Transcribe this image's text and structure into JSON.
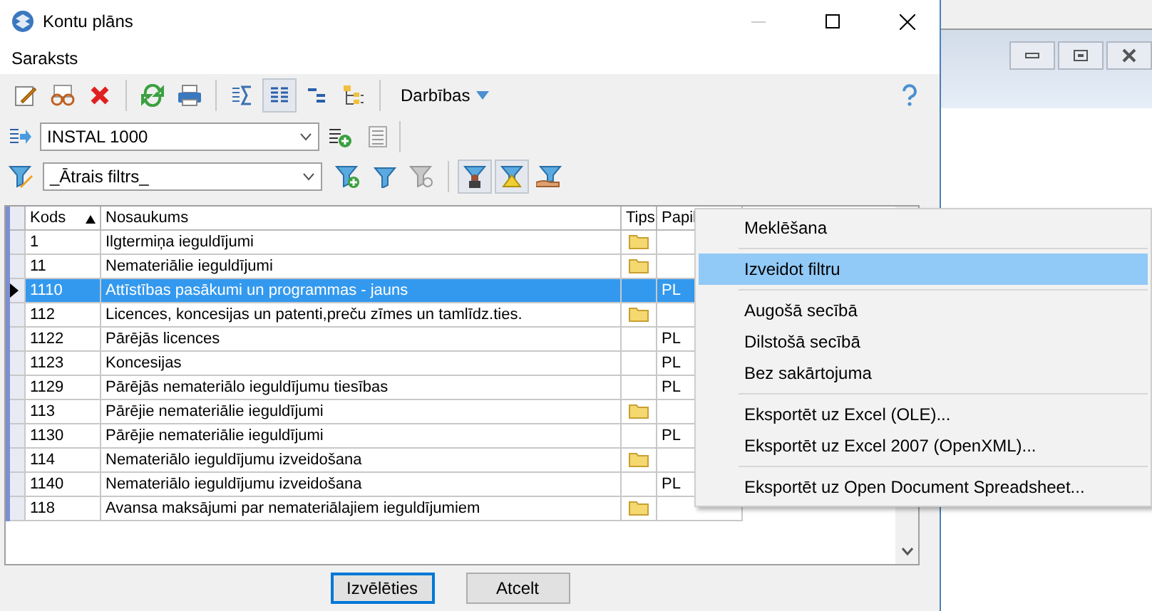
{
  "window": {
    "title": "Kontu plāns"
  },
  "menu": [
    "Saraksts"
  ],
  "toolbar": {
    "icons": [
      {
        "kind": "edit",
        "pressed": false
      },
      {
        "kind": "glasses",
        "pressed": false
      },
      {
        "kind": "delete",
        "pressed": false
      },
      {
        "kind": "sep"
      },
      {
        "kind": "refresh",
        "pressed": false
      },
      {
        "kind": "print",
        "pressed": false
      },
      {
        "kind": "sep"
      },
      {
        "kind": "sum",
        "pressed": false
      },
      {
        "kind": "columns",
        "pressed": true
      },
      {
        "kind": "indent",
        "pressed": false
      },
      {
        "kind": "tree",
        "pressed": false
      },
      {
        "kind": "sep"
      }
    ],
    "actions": "Darbības"
  },
  "plan": {
    "value": "INSTAL 1000"
  },
  "filter": {
    "value": "_Ātrais filtrs_",
    "buttons": [
      {
        "kind": "add",
        "pressed": false
      },
      {
        "kind": "plain",
        "pressed": false
      },
      {
        "kind": "disabled",
        "pressed": false
      },
      {
        "kind": "person",
        "pressed": true
      },
      {
        "kind": "warning",
        "pressed": true
      },
      {
        "kind": "hand",
        "pressed": false
      }
    ]
  },
  "table": {
    "columns": [
      {
        "label": "Kods",
        "sorted": true
      },
      {
        "label": "Nosaukums"
      },
      {
        "label": "Tips"
      },
      {
        "label": "Papil"
      }
    ],
    "rows": [
      {
        "code": "1",
        "name": "Ilgtermiņa ieguldījumi",
        "folder": true,
        "extra": "",
        "selected": false
      },
      {
        "code": "11",
        "name": "Nemateriālie ieguldījumi",
        "folder": true,
        "extra": "",
        "selected": false
      },
      {
        "code": "1110",
        "name": "Attīstības pasākumi un programmas - jauns",
        "folder": false,
        "extra": "PL",
        "selected": true
      },
      {
        "code": "112",
        "name": "Licences, koncesijas un patenti,preču zīmes un tamlīdz.ties.",
        "folder": true,
        "extra": "",
        "selected": false
      },
      {
        "code": "1122",
        "name": "Pārējās licences",
        "folder": false,
        "extra": "PL",
        "selected": false
      },
      {
        "code": "1123",
        "name": "Koncesijas",
        "folder": false,
        "extra": "PL",
        "selected": false
      },
      {
        "code": "1129",
        "name": "Pārējās nemateriālo ieguldījumu tiesības",
        "folder": false,
        "extra": "PL",
        "selected": false
      },
      {
        "code": "113",
        "name": "Pārējie nemateriālie ieguldījumi",
        "folder": true,
        "extra": "",
        "selected": false
      },
      {
        "code": "1130",
        "name": "Pārējie nemateriālie ieguldījumi",
        "folder": false,
        "extra": "PL",
        "selected": false
      },
      {
        "code": "114",
        "name": "Nemateriālo ieguldījumu izveidošana",
        "folder": true,
        "extra": "",
        "selected": false
      },
      {
        "code": "1140",
        "name": "Nemateriālo ieguldījumu izveidošana",
        "folder": false,
        "extra": "PL",
        "selected": false
      },
      {
        "code": "118",
        "name": "Avansa maksājumi par nemateriālajiem ieguldījumiem",
        "folder": true,
        "extra": "",
        "selected": false
      }
    ]
  },
  "buttons": [
    {
      "label": "Izvēlēties",
      "focused": true
    },
    {
      "label": "Atcelt",
      "focused": false
    }
  ],
  "context_menu": [
    [
      {
        "label": "Meklēšana",
        "selected": false
      }
    ],
    [
      {
        "label": "Izveidot filtru",
        "selected": true
      }
    ],
    [
      {
        "label": "Augošā secībā",
        "selected": false
      },
      {
        "label": "Dilstošā secībā",
        "selected": false
      },
      {
        "label": "Bez sakārtojuma",
        "selected": false
      }
    ],
    [
      {
        "label": "Eksportēt uz Excel (OLE)...",
        "selected": false
      },
      {
        "label": "Eksportēt uz Excel 2007 (OpenXML)...",
        "selected": false
      }
    ],
    [
      {
        "label": "Eksportēt uz Open Document Spreadsheet...",
        "selected": false
      }
    ]
  ]
}
